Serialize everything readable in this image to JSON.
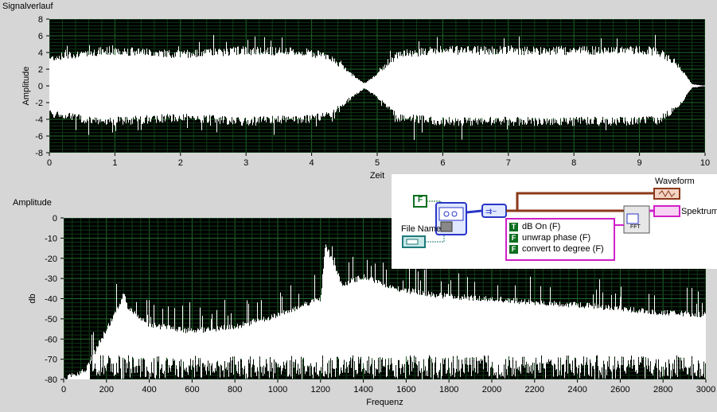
{
  "top_graph": {
    "label": "Signalverlauf",
    "xlabel": "Zeit",
    "ylabel": "Amplitude",
    "xticks": [
      "0",
      "1",
      "2",
      "3",
      "4",
      "5",
      "6",
      "7",
      "8",
      "9",
      "10"
    ],
    "yticks": [
      "8",
      "6",
      "4",
      "2",
      "0",
      "-2",
      "-4",
      "-6",
      "-8"
    ]
  },
  "bottom_graph": {
    "label": "Amplitude",
    "xlabel": "Frequenz",
    "ylabel": "db",
    "xticks": [
      "0",
      "200",
      "400",
      "600",
      "800",
      "1000",
      "1200",
      "1400",
      "1600",
      "1800",
      "2000",
      "2200",
      "2400",
      "2600",
      "2800",
      "3000"
    ],
    "yticks": [
      "0",
      "-10",
      "-20",
      "-30",
      "-40",
      "-50",
      "-60",
      "-70",
      "-80"
    ]
  },
  "block_diagram": {
    "bool_const": "F",
    "file_name_label": "File Name",
    "waveform_label": "Waveform",
    "spectrum_label": "Spektrum",
    "fft_label": "FFT",
    "options": [
      {
        "flag": "T",
        "text": "dB On (F)"
      },
      {
        "flag": "F",
        "text": "unwrap phase (F)"
      },
      {
        "flag": "F",
        "text": "convert to degree (F)"
      }
    ]
  },
  "chart_data": [
    {
      "type": "area",
      "title": "Signalverlauf",
      "xlabel": "Zeit",
      "ylabel": "Amplitude",
      "xlim": [
        0,
        10
      ],
      "ylim": [
        -8,
        8
      ],
      "grid": true,
      "series": [
        {
          "x": [
            0.0,
            0.5,
            1.0,
            2.0,
            3.0,
            4.0,
            4.3,
            4.6,
            4.8,
            5.0,
            5.3,
            6.0,
            7.0,
            8.0,
            9.0,
            9.3,
            9.6,
            9.8,
            10.0
          ],
          "envelope": [
            3.5,
            4.2,
            4.5,
            4.0,
            4.5,
            4.2,
            3.5,
            1.5,
            0.3,
            1.5,
            4.0,
            4.5,
            4.5,
            4.5,
            4.5,
            4.3,
            2.5,
            0.2,
            0.0
          ]
        }
      ]
    },
    {
      "type": "area",
      "title": "Amplitude",
      "xlabel": "Frequenz",
      "ylabel": "db",
      "xlim": [
        0,
        3000
      ],
      "ylim": [
        -80,
        0
      ],
      "grid": true,
      "series": [
        {
          "x": [
            0,
            100,
            200,
            250,
            280,
            300,
            400,
            600,
            800,
            1000,
            1200,
            1220,
            1300,
            1400,
            1500,
            1600,
            1800,
            2000,
            2200,
            2400,
            2600,
            2800,
            3000
          ],
          "upper": [
            -80,
            -75,
            -55,
            -45,
            -37,
            -45,
            -53,
            -56,
            -54,
            -48,
            -40,
            -13,
            -33,
            -29,
            -33,
            -36,
            -39,
            -40,
            -42,
            -43,
            -45,
            -47,
            -48
          ]
        }
      ]
    }
  ]
}
